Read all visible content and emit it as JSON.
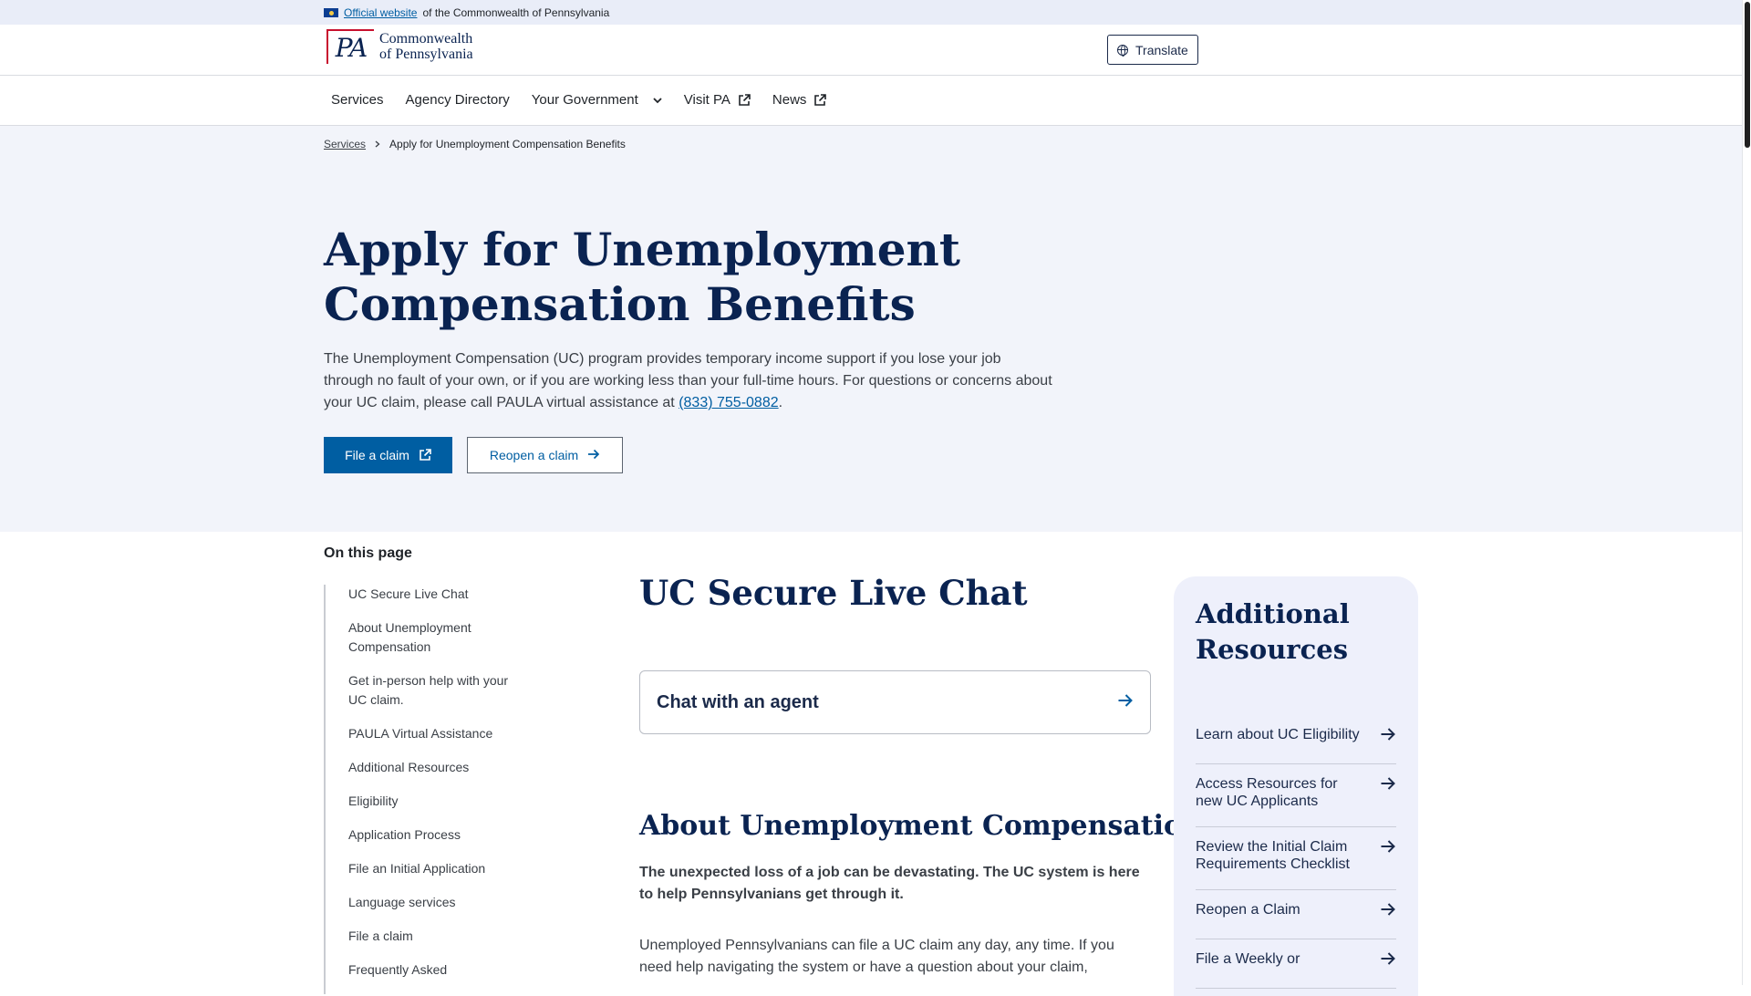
{
  "banner": {
    "link_text": "Official website",
    "rest_text": "of the Commonwealth of Pennsylvania"
  },
  "header": {
    "logo_mark": "PA",
    "logo_line1": "Commonwealth",
    "logo_line2": "of Pennsylvania",
    "translate_label": "Translate"
  },
  "nav": {
    "items": [
      {
        "label": "Services"
      },
      {
        "label": "Agency Directory"
      },
      {
        "label": "Your Government"
      },
      {
        "label": "Visit PA"
      },
      {
        "label": "News"
      }
    ]
  },
  "breadcrumb": {
    "parent": "Services",
    "current": "Apply for Unemployment Compensation Benefits"
  },
  "hero": {
    "title": "Apply for Unemployment Compensation Benefits",
    "intro": "The Unemployment Compensation (UC) program provides temporary income support if you lose your job through no fault of your own, or if you are working less than your full-time hours. For questions or concerns about your UC claim, please call PAULA virtual assistance at ",
    "phone": "(833) 755-0882",
    "intro_end": ".",
    "file_claim_label": "File a claim",
    "reopen_claim_label": "Reopen a claim"
  },
  "toc": {
    "heading": "On this page",
    "items": [
      "UC Secure Live Chat",
      "About Unemployment Compensation",
      "Get in-person help with your UC claim.",
      "PAULA Virtual Assistance",
      "Additional Resources",
      "Eligibility",
      "Application Process",
      "File an Initial Application",
      "Language services",
      "File a claim",
      "Frequently Asked"
    ]
  },
  "main": {
    "chat_title": "UC Secure Live Chat",
    "chat_card_label": "Chat with an agent",
    "about_title": "About Unemployment Compensation",
    "about_lead": "The unexpected loss of a job can be devastating. The UC system is here to help Pennsylvanians get through it.",
    "about_body": "Unemployed Pennsylvanians can file a UC claim any day, any time. If you need help navigating the system or have a question about your claim,"
  },
  "sidebar": {
    "title": "Additional Resources",
    "items": [
      "Learn about UC Eligibility",
      "Access Resources for new UC Applicants",
      "Review the Initial Claim Requirements Checklist",
      "Reopen a Claim",
      "File a Weekly or"
    ]
  },
  "colors": {
    "brand_navy": "#0a2351",
    "link_blue": "#005ea2",
    "hero_bg": "#f2f4fa",
    "sidebar_bg": "#eef0fb"
  }
}
